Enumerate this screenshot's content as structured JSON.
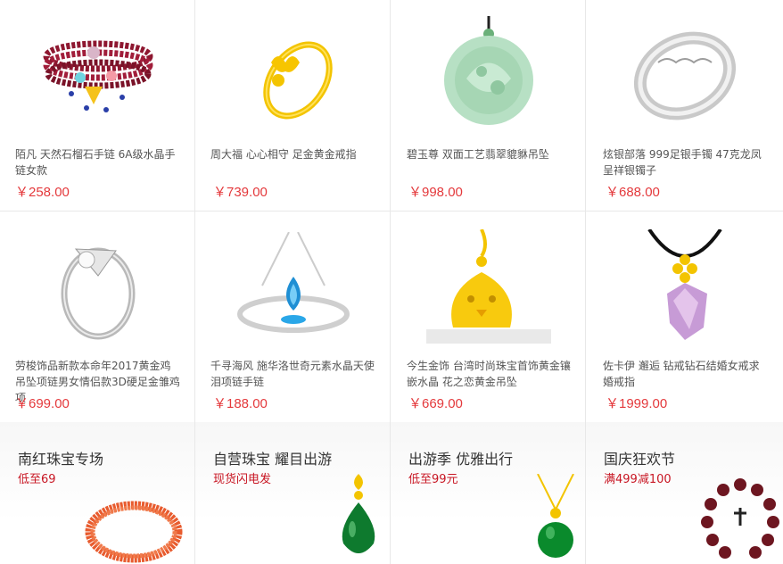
{
  "products": [
    {
      "name": "陌凡 天然石榴石手链 6A级水晶手链女款",
      "price": "￥258.00",
      "icon": "garnet-bracelet-image"
    },
    {
      "name": "周大福 心心相守 足金黄金戒指",
      "price": "￥739.00",
      "icon": "gold-ring-image"
    },
    {
      "name": "碧玉尊 双面工艺翡翠貔貅吊坠",
      "price": "￥998.00",
      "icon": "jade-pendant-image"
    },
    {
      "name": "炫银部落 999足银手镯 47克龙凤呈祥银镯子",
      "price": "￥688.00",
      "icon": "silver-bangle-image"
    },
    {
      "name": "劳梭饰品新款本命年2017黄金鸡吊坠项链男女情侣款3D硬足金雏鸡项",
      "price": "￥699.00",
      "icon": "diamond-ring-image"
    },
    {
      "name": "千寻海风 施华洛世奇元素水晶天使泪项链手链",
      "price": "￥188.00",
      "icon": "blue-crystal-necklace-image"
    },
    {
      "name": "今生金饰 台湾时尚珠宝首饰黄金镶嵌水晶 花之恋黄金吊坠",
      "price": "￥669.00",
      "icon": "gold-chick-pendant-image"
    },
    {
      "name": "佐卡伊 邂逅 钻戒钻石结婚女戒求婚戒指",
      "price": "￥1999.00",
      "icon": "crystal-pendant-image"
    }
  ],
  "promos": [
    {
      "title": "南红珠宝专场",
      "subtitle": "低至69",
      "icon": "red-bead-bracelet-image"
    },
    {
      "title": "自营珠宝 耀目出游",
      "subtitle": "现货闪电发",
      "icon": "green-drop-pendant-image"
    },
    {
      "title": "出游季 优雅出行",
      "subtitle": "低至99元",
      "icon": "green-round-pendant-image"
    },
    {
      "title": "国庆狂欢节",
      "subtitle": "满499减100",
      "icon": "bead-mala-image"
    }
  ],
  "colors": {
    "price": "#e4393c",
    "promo_sub": "#c81623",
    "border": "#e8e8e8"
  }
}
